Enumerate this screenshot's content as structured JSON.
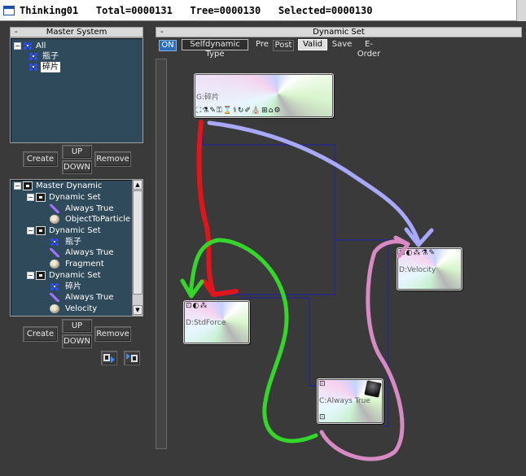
{
  "window": {
    "title": "Thinking01   Total=0000131   Tree=0000130   Selected=0000130"
  },
  "master_system": {
    "header": "Master System",
    "collapse": "-",
    "tree": [
      {
        "label": "All"
      },
      {
        "label": "瓶子"
      },
      {
        "label": "碎片",
        "selected": true
      }
    ],
    "buttons": {
      "create": "Create",
      "up": "UP",
      "down": "DOWN",
      "remove": "Remove"
    }
  },
  "master_dynamic": {
    "tree": [
      {
        "label": "Master Dynamic",
        "icon": "dynamic-icon"
      },
      {
        "label": "Dynamic Set",
        "icon": "dynamic-icon"
      },
      {
        "label": "Always True",
        "icon": "pen-icon"
      },
      {
        "label": "ObjectToParticle",
        "icon": "face-icon"
      },
      {
        "label": "Dynamic Set",
        "icon": "dynamic-icon"
      },
      {
        "label": "瓶子",
        "icon": "group-icon"
      },
      {
        "label": "Always True",
        "icon": "pen-icon"
      },
      {
        "label": "Fragment",
        "icon": "face-icon"
      },
      {
        "label": "Dynamic Set",
        "icon": "dynamic-icon"
      },
      {
        "label": "碎片",
        "icon": "group-icon"
      },
      {
        "label": "Always True",
        "icon": "pen-icon"
      },
      {
        "label": "Velocity",
        "icon": "face-icon"
      }
    ],
    "buttons": {
      "create": "Create",
      "up": "UP",
      "down": "DOWN",
      "remove": "Remove"
    }
  },
  "dynamic_set": {
    "header": "Dynamic Set",
    "collapse": "-",
    "toolbar": {
      "on": "ON",
      "selfdynamic": "Selfdynamic Type",
      "pre": "Pre",
      "post": "Post",
      "valid": "Valid",
      "save": "Save",
      "eorder": "E-Order"
    },
    "nodes": {
      "group": {
        "label": "G:碎片",
        "icons": "⛶⚗✎⚿⌛⚕↻✐⛪⊞⌂⚙"
      },
      "force": {
        "label": "D:StdForce",
        "icons": "⊡◐⁂"
      },
      "velocity": {
        "label": "D:Velocity",
        "icons": "⊡◐⁂⚗✎"
      },
      "condition": {
        "label": "C:Always True",
        "icons_top": "⊡",
        "icons_bottom": "⊡"
      }
    }
  },
  "colors": {
    "background": "#3a3a3a",
    "tree_bg": "#2f4a5b",
    "on_button": "#2d6fb5",
    "link_line": "#2020b0",
    "red_stroke": "#e0141b",
    "green_stroke": "#34d62a",
    "lavender_stroke": "#a9a8ff",
    "pink_stroke": "#d88ac4"
  }
}
